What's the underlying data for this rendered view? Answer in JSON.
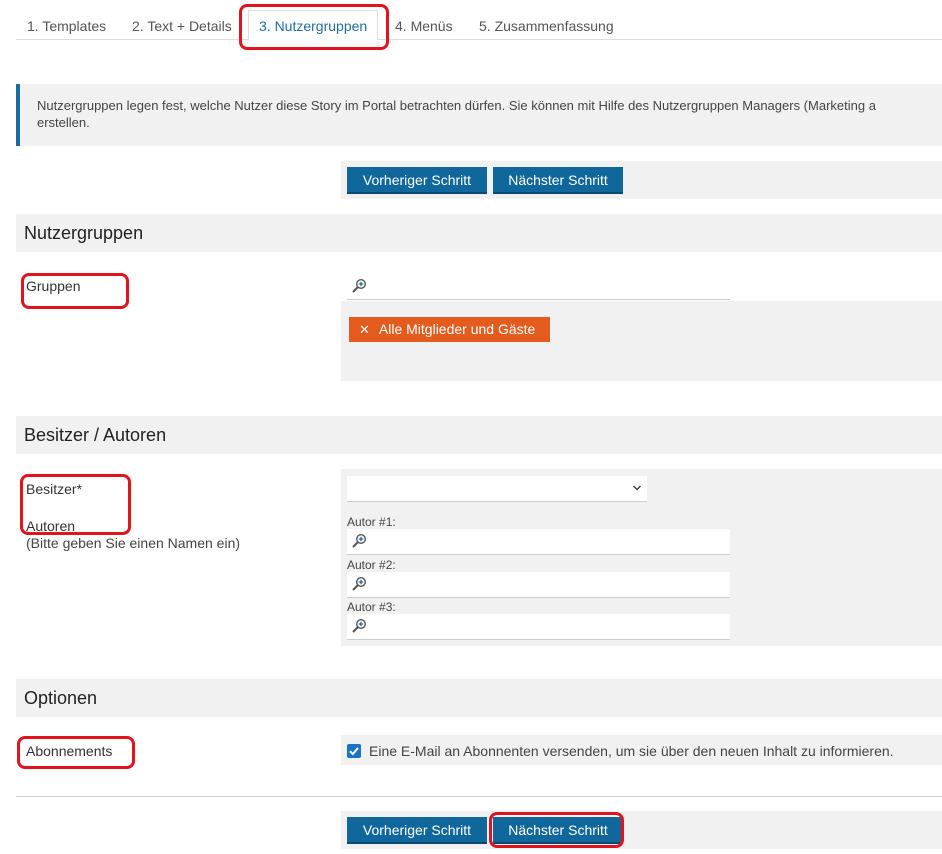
{
  "tabs": [
    {
      "label": "1. Templates"
    },
    {
      "label": "2. Text + Details"
    },
    {
      "label": "3. Nutzergruppen",
      "active": true
    },
    {
      "label": "4. Menüs"
    },
    {
      "label": "5. Zusammenfassung"
    }
  ],
  "info": {
    "line1": "Nutzergruppen legen fest, welche Nutzer diese Story im Portal betrachten dürfen. Sie können mit Hilfe des Nutzergruppen Managers (Marketing a",
    "line2": "erstellen."
  },
  "buttons": {
    "prev": "Vorheriger Schritt",
    "next": "Nächster Schritt"
  },
  "sections": {
    "nutzergruppen": {
      "title": "Nutzergruppen",
      "gruppen_label": "Gruppen",
      "gruppen_tag": "Alle Mitglieder und Gäste"
    },
    "besitzer": {
      "title": "Besitzer / Autoren",
      "besitzer_label": "Besitzer*",
      "autoren_label": "Autoren",
      "autoren_hint": "(Bitte geben Sie einen Namen ein)",
      "autor1": "Autor #1:",
      "autor2": "Autor #2:",
      "autor3": "Autor #3:"
    },
    "optionen": {
      "title": "Optionen",
      "abo_label": "Abonnements",
      "abo_text": "Eine E-Mail an Abonnenten versenden, um sie über den neuen Inhalt zu informieren.",
      "abo_checked": true
    }
  },
  "colors": {
    "primary_button": "#10679b",
    "tag": "#e35b1d",
    "annotation": "#e0141e"
  }
}
